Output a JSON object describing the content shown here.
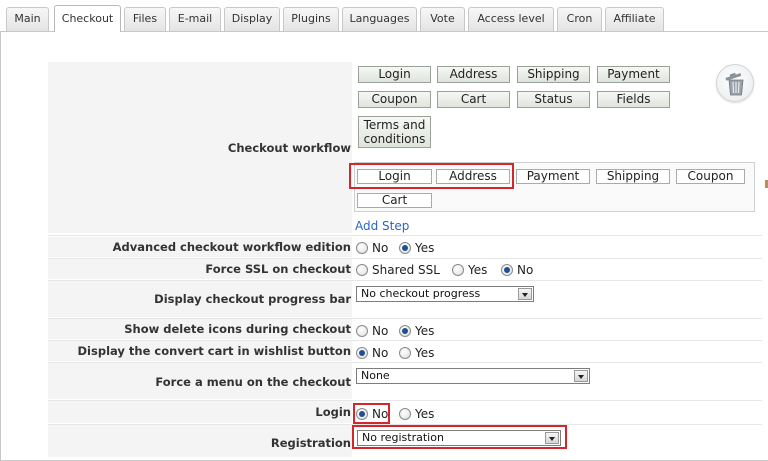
{
  "tabs": [
    {
      "label": "Main",
      "active": false
    },
    {
      "label": "Checkout",
      "active": true
    },
    {
      "label": "Files",
      "active": false
    },
    {
      "label": "E-mail",
      "active": false
    },
    {
      "label": "Display",
      "active": false
    },
    {
      "label": "Plugins",
      "active": false
    },
    {
      "label": "Languages",
      "active": false
    },
    {
      "label": "Vote",
      "active": false
    },
    {
      "label": "Access level",
      "active": false
    },
    {
      "label": "Cron",
      "active": false
    },
    {
      "label": "Affiliate",
      "active": false
    }
  ],
  "workflow": {
    "label": "Checkout workflow",
    "available_steps": [
      "Login",
      "Address",
      "Shipping",
      "Payment",
      "Coupon",
      "Cart",
      "Status",
      "Fields",
      "Terms and conditions"
    ],
    "selected_steps": [
      "Login",
      "Address",
      "Payment",
      "Shipping",
      "Coupon",
      "Cart"
    ],
    "add_step": "Add Step",
    "trash_icon": "trash-icon"
  },
  "fields": {
    "advanced": {
      "label": "Advanced checkout workflow edition",
      "options": [
        "No",
        "Yes"
      ],
      "selected": "Yes"
    },
    "ssl": {
      "label": "Force SSL on checkout",
      "options": [
        "Shared SSL",
        "Yes",
        "No"
      ],
      "selected": "No"
    },
    "progress": {
      "label": "Display checkout progress bar",
      "value": "No checkout progress"
    },
    "delete_icons": {
      "label": "Show delete icons during checkout",
      "options": [
        "No",
        "Yes"
      ],
      "selected": "Yes"
    },
    "wishlist": {
      "label": "Display the convert cart in wishlist button",
      "options": [
        "No",
        "Yes"
      ],
      "selected": "No"
    },
    "menu": {
      "label": "Force a menu on the checkout",
      "value": "None"
    },
    "login": {
      "label": "Login",
      "options": [
        "No",
        "Yes"
      ],
      "selected": "No"
    },
    "registration": {
      "label": "Registration",
      "value": "No registration"
    }
  },
  "colors": {
    "highlight": "#d4262c",
    "link": "#2a65c4",
    "radio_dot": "#1f4f93"
  }
}
